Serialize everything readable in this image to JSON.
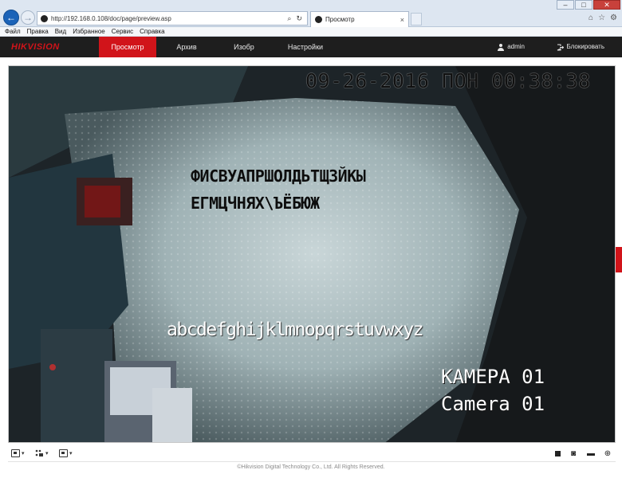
{
  "browser": {
    "url": "http://192.168.0.108/doc/page/preview.asp",
    "tab_title": "Просмотр",
    "tab_close": "×",
    "search_glyph": "⌕",
    "refresh_glyph": "↻",
    "back_glyph": "←",
    "forward_glyph": "→",
    "window_controls": {
      "minimize": "–",
      "maximize": "□",
      "close": "✕"
    },
    "chrome_icons": {
      "home": "⌂",
      "favorites": "☆",
      "settings": "⚙"
    }
  },
  "menu": [
    "Файл",
    "Правка",
    "Вид",
    "Избранное",
    "Сервис",
    "Справка"
  ],
  "app": {
    "brand": "HIKVISION",
    "nav": {
      "preview": "Просмотр",
      "archive": "Архив",
      "image": "Изобр",
      "settings": "Настройки"
    },
    "user": "admin",
    "lock": "Блокировать"
  },
  "video": {
    "osd_datetime": "09-26-2016 ПОН 00:38:38",
    "osd_cyrillic_line1": "ФИСВУАПРШОЛДЬТЩЗЙКЫ",
    "osd_cyrillic_line2": "ЕГМЦЧНЯХ\\ЪЁБЮЖ",
    "osd_latin": "abcdefghijklmnopqrstuvwxyz",
    "osd_camera_ru": "КАМЕРА 01",
    "osd_camera_en": "Camera 01"
  },
  "toolbar": {
    "caret": "▾",
    "snapshot_glyph": "◙",
    "record_glyph": "▬",
    "zoom_glyph": "⊕"
  },
  "footer": "©Hikvision Digital Technology Co., Ltd. All Rights Reserved.",
  "colors": {
    "brand_red": "#d1141a",
    "header_bg": "#1e1e1e",
    "chrome_bg": "#dde6f1"
  }
}
